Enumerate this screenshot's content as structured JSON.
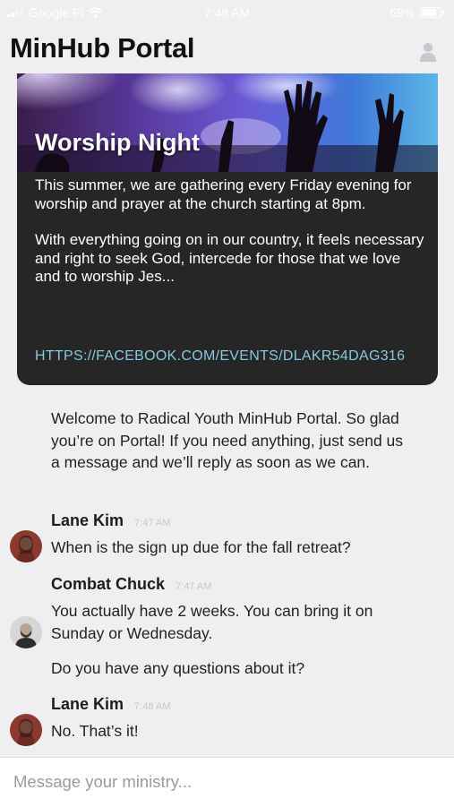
{
  "status_bar": {
    "carrier": "Google Fi",
    "time": "7:48 AM",
    "battery": "69%"
  },
  "header": {
    "title": "MinHub Portal"
  },
  "event_card": {
    "title": "Worship Night",
    "paragraph1": "This summer, we are gathering every Friday evening for worship and prayer at the church starting at 8pm.",
    "paragraph2": "With everything going on in our country, it feels necessary and right to seek God, intercede for those that we love and to worship Jes...",
    "link": "HTTPS://FACEBOOK.COM/EVENTS/DLAKR54DAG316"
  },
  "welcome_message": "Welcome to Radical Youth MinHub Portal. So glad you’re on Portal! If you need anything, just send us a message and we’ll reply as soon as we can.",
  "messages": [
    {
      "sender": "Lane Kim",
      "time": "7:47 AM",
      "lines": [
        "When is the sign up due for the fall retreat?"
      ]
    },
    {
      "sender": "Combat Chuck",
      "time": "7:47 AM",
      "lines": [
        "You actually have 2 weeks. You can bring it on Sunday or Wednesday.",
        "Do you have any questions about it?"
      ]
    },
    {
      "sender": "Lane Kim",
      "time": "7:48 AM",
      "lines": [
        "No. That’s it!"
      ]
    }
  ],
  "composer": {
    "placeholder": "Message your ministry..."
  },
  "icons": {
    "profile": "person-icon",
    "wifi": "wifi-icon",
    "signal": "cellular-signal-icon",
    "battery": "battery-icon"
  },
  "colors": {
    "link": "#86c8e0",
    "card_dark": "#262626",
    "background": "#efeff1"
  }
}
